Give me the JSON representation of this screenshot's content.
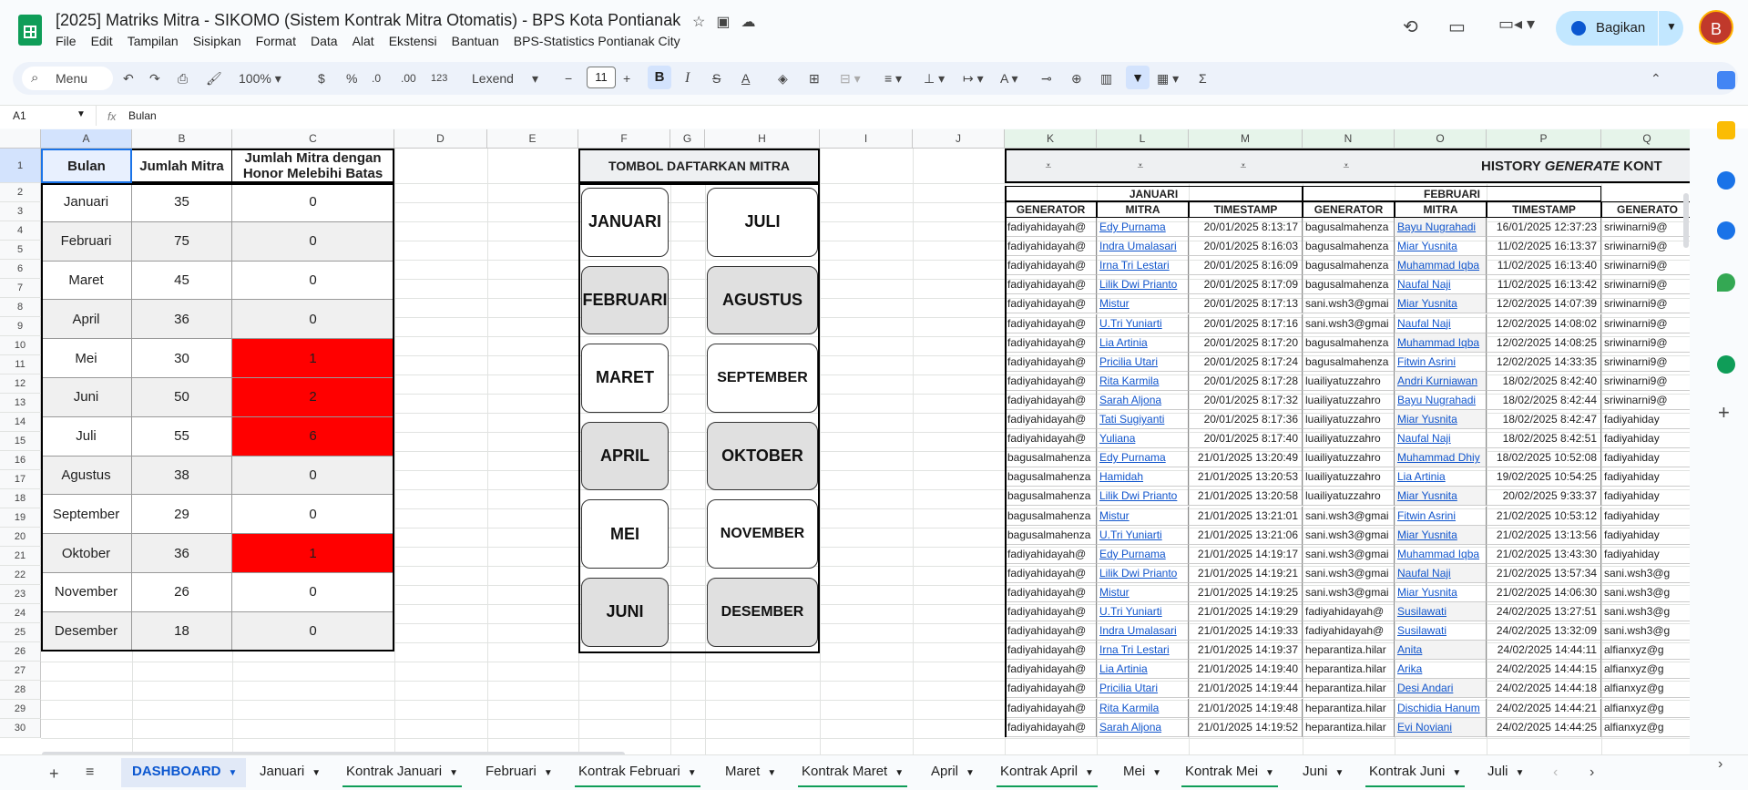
{
  "app": {
    "title": "[2025] Matriks Mitra - SIKOMO (Sistem Kontrak Mitra Otomatis) - BPS Kota Pontianak",
    "share_label": "Bagikan",
    "avatar_letter": "B"
  },
  "menu": [
    "File",
    "Edit",
    "Tampilan",
    "Sisipkan",
    "Format",
    "Data",
    "Alat",
    "Ekstensi",
    "Bantuan",
    "BPS-Statistics Pontianak City"
  ],
  "toolbar": {
    "menu_search": "Menu",
    "zoom": "100%",
    "currency": "$",
    "percent": "%",
    "dec_dec": ".0",
    "inc_dec": ".00",
    "format123": "123",
    "font": "Lexend",
    "font_size": "11",
    "bold": "B",
    "italic": "I"
  },
  "formula": {
    "cell_ref": "A1",
    "fx": "fx",
    "value": "Bulan"
  },
  "columns": [
    "A",
    "B",
    "C",
    "D",
    "E",
    "F",
    "G",
    "H",
    "I",
    "J",
    "K",
    "L",
    "M",
    "N",
    "O",
    "P",
    "Q"
  ],
  "rows": [
    "1",
    "2",
    "3",
    "4",
    "5",
    "6",
    "7",
    "8",
    "9",
    "10",
    "11",
    "12",
    "13",
    "14",
    "15",
    "16",
    "17",
    "18",
    "19",
    "20",
    "21",
    "22",
    "23",
    "24",
    "25",
    "26",
    "27",
    "28",
    "29",
    "30"
  ],
  "summary": {
    "headers": [
      "Bulan",
      "Jumlah Mitra",
      "Jumlah Mitra dengan Honor Melebihi Batas"
    ],
    "rows": [
      [
        "Januari",
        "35",
        "0"
      ],
      [
        "Februari",
        "75",
        "0"
      ],
      [
        "Maret",
        "45",
        "0"
      ],
      [
        "April",
        "36",
        "0"
      ],
      [
        "Mei",
        "30",
        "1"
      ],
      [
        "Juni",
        "50",
        "2"
      ],
      [
        "Juli",
        "55",
        "6"
      ],
      [
        "Agustus",
        "38",
        "0"
      ],
      [
        "September",
        "29",
        "0"
      ],
      [
        "Oktober",
        "36",
        "1"
      ],
      [
        "November",
        "26",
        "0"
      ],
      [
        "Desember",
        "18",
        "0"
      ]
    ]
  },
  "tombol": {
    "header": "TOMBOL DAFTARKAN MITRA",
    "left": [
      "JANUARI",
      "FEBRUARI",
      "MARET",
      "APRIL",
      "MEI",
      "JUNI"
    ],
    "right": [
      "JULI",
      "AGUSTUS",
      "SEPTEMBER",
      "OKTOBER",
      "NOVEMBER",
      "DESEMBER"
    ]
  },
  "history": {
    "title_pre": "HISTORY ",
    "title_em": "GENERATE",
    "title_post": " KONT",
    "months": [
      "JANUARI",
      "FEBRUARI"
    ],
    "subheaders": [
      "GENERATOR",
      "MITRA",
      "TIMESTAMP",
      "GENERATOR",
      "MITRA",
      "TIMESTAMP",
      "GENERATO"
    ],
    "rows": [
      [
        "fadiyahidayah@",
        "Edy Purnama",
        "20/01/2025 8:13:17",
        "bagusalmahenza",
        "Bayu Nugrahadi",
        "16/01/2025 12:37:23",
        "sriwinarni9@"
      ],
      [
        "fadiyahidayah@",
        "Indra Umalasari",
        "20/01/2025 8:16:03",
        "bagusalmahenza",
        "Miar Yusnita",
        "11/02/2025 16:13:37",
        "sriwinarni9@"
      ],
      [
        "fadiyahidayah@",
        "Irna Tri Lestari",
        "20/01/2025 8:16:09",
        "bagusalmahenza",
        "Muhammad Iqba",
        "11/02/2025 16:13:40",
        "sriwinarni9@"
      ],
      [
        "fadiyahidayah@",
        "Lilik Dwi Prianto",
        "20/01/2025 8:17:09",
        "bagusalmahenza",
        "Naufal Naji",
        "11/02/2025 16:13:42",
        "sriwinarni9@"
      ],
      [
        "fadiyahidayah@",
        "Mistur",
        "20/01/2025 8:17:13",
        "sani.wsh3@gmai",
        "Miar Yusnita",
        "12/02/2025 14:07:39",
        "sriwinarni9@"
      ],
      [
        "fadiyahidayah@",
        "U.Tri Yuniarti",
        "20/01/2025 8:17:16",
        "sani.wsh3@gmai",
        "Naufal Naji",
        "12/02/2025 14:08:02",
        "sriwinarni9@"
      ],
      [
        "fadiyahidayah@",
        "Lia Artinia",
        "20/01/2025 8:17:20",
        "bagusalmahenza",
        "Muhammad Iqba",
        "12/02/2025 14:08:25",
        "sriwinarni9@"
      ],
      [
        "fadiyahidayah@",
        "Pricilia Utari",
        "20/01/2025 8:17:24",
        "bagusalmahenza",
        "Fitwin Asrini",
        "12/02/2025 14:33:35",
        "sriwinarni9@"
      ],
      [
        "fadiyahidayah@",
        "Rita Karmila",
        "20/01/2025 8:17:28",
        "luailiyatuzzahro",
        "Andri Kurniawan",
        "18/02/2025 8:42:40",
        "sriwinarni9@"
      ],
      [
        "fadiyahidayah@",
        "Sarah Aljona",
        "20/01/2025 8:17:32",
        "luailiyatuzzahro",
        "Bayu Nugrahadi",
        "18/02/2025 8:42:44",
        "sriwinarni9@"
      ],
      [
        "fadiyahidayah@",
        "Tati Sugiyanti",
        "20/01/2025 8:17:36",
        "luailiyatuzzahro",
        "Miar Yusnita",
        "18/02/2025 8:42:47",
        "fadiyahiday"
      ],
      [
        "fadiyahidayah@",
        "Yuliana",
        "20/01/2025 8:17:40",
        "luailiyatuzzahro",
        "Naufal Naji",
        "18/02/2025 8:42:51",
        "fadiyahiday"
      ],
      [
        "bagusalmahenza",
        "Edy Purnama",
        "21/01/2025 13:20:49",
        "luailiyatuzzahro",
        "Muhammad Dhiy",
        "18/02/2025 10:52:08",
        "fadiyahiday"
      ],
      [
        "bagusalmahenza",
        "Hamidah",
        "21/01/2025 13:20:53",
        "luailiyatuzzahro",
        "Lia Artinia",
        "19/02/2025 10:54:25",
        "fadiyahiday"
      ],
      [
        "bagusalmahenza",
        "Lilik Dwi Prianto",
        "21/01/2025 13:20:58",
        "luailiyatuzzahro",
        "Miar Yusnita",
        "20/02/2025 9:33:37",
        "fadiyahiday"
      ],
      [
        "bagusalmahenza",
        "Mistur",
        "21/01/2025 13:21:01",
        "sani.wsh3@gmai",
        "Fitwin Asrini",
        "21/02/2025 10:53:12",
        "fadiyahiday"
      ],
      [
        "bagusalmahenza",
        "U.Tri Yuniarti",
        "21/01/2025 13:21:06",
        "sani.wsh3@gmai",
        "Miar Yusnita",
        "21/02/2025 13:13:56",
        "fadiyahiday"
      ],
      [
        "fadiyahidayah@",
        "Edy Purnama",
        "21/01/2025 14:19:17",
        "sani.wsh3@gmai",
        "Muhammad Iqba",
        "21/02/2025 13:43:30",
        "fadiyahiday"
      ],
      [
        "fadiyahidayah@",
        "Lilik Dwi Prianto",
        "21/01/2025 14:19:21",
        "sani.wsh3@gmai",
        "Naufal Naji",
        "21/02/2025 13:57:34",
        "sani.wsh3@g"
      ],
      [
        "fadiyahidayah@",
        "Mistur",
        "21/01/2025 14:19:25",
        "sani.wsh3@gmai",
        "Miar Yusnita",
        "21/02/2025 14:06:30",
        "sani.wsh3@g"
      ],
      [
        "fadiyahidayah@",
        "U.Tri Yuniarti",
        "21/01/2025 14:19:29",
        "fadiyahidayah@",
        "Susilawati",
        "24/02/2025 13:27:51",
        "sani.wsh3@g"
      ],
      [
        "fadiyahidayah@",
        "Indra Umalasari",
        "21/01/2025 14:19:33",
        "fadiyahidayah@",
        "Susilawati",
        "24/02/2025 13:32:09",
        "sani.wsh3@g"
      ],
      [
        "fadiyahidayah@",
        "Irna Tri Lestari",
        "21/01/2025 14:19:37",
        "heparantiza.hilar",
        "Anita",
        "24/02/2025 14:44:11",
        "alfianxyz@g"
      ],
      [
        "fadiyahidayah@",
        "Lia Artinia",
        "21/01/2025 14:19:40",
        "heparantiza.hilar",
        "Arika",
        "24/02/2025 14:44:15",
        "alfianxyz@g"
      ],
      [
        "fadiyahidayah@",
        "Pricilia Utari",
        "21/01/2025 14:19:44",
        "heparantiza.hilar",
        "Desi Andari",
        "24/02/2025 14:44:18",
        "alfianxyz@g"
      ],
      [
        "fadiyahidayah@",
        "Rita Karmila",
        "21/01/2025 14:19:48",
        "heparantiza.hilar",
        "Dischidia Hanum",
        "24/02/2025 14:44:21",
        "alfianxyz@g"
      ],
      [
        "fadiyahidayah@",
        "Sarah Aljona",
        "21/01/2025 14:19:52",
        "heparantiza.hilar",
        "Evi Noviani",
        "24/02/2025 14:44:25",
        "alfianxyz@g"
      ]
    ]
  },
  "tabs": [
    "DASHBOARD",
    "Januari",
    "Kontrak Januari",
    "Februari",
    "Kontrak Februari",
    "Maret",
    "Kontrak Maret",
    "April",
    "Kontrak April",
    "Mei",
    "Kontrak Mei",
    "Juni",
    "Kontrak Juni",
    "Juli"
  ],
  "colors": {
    "accent": "#0b57d0",
    "share_bg": "#c2e7ff",
    "over_limit": "#ff0000",
    "sheet_green": "#0f9d58"
  }
}
